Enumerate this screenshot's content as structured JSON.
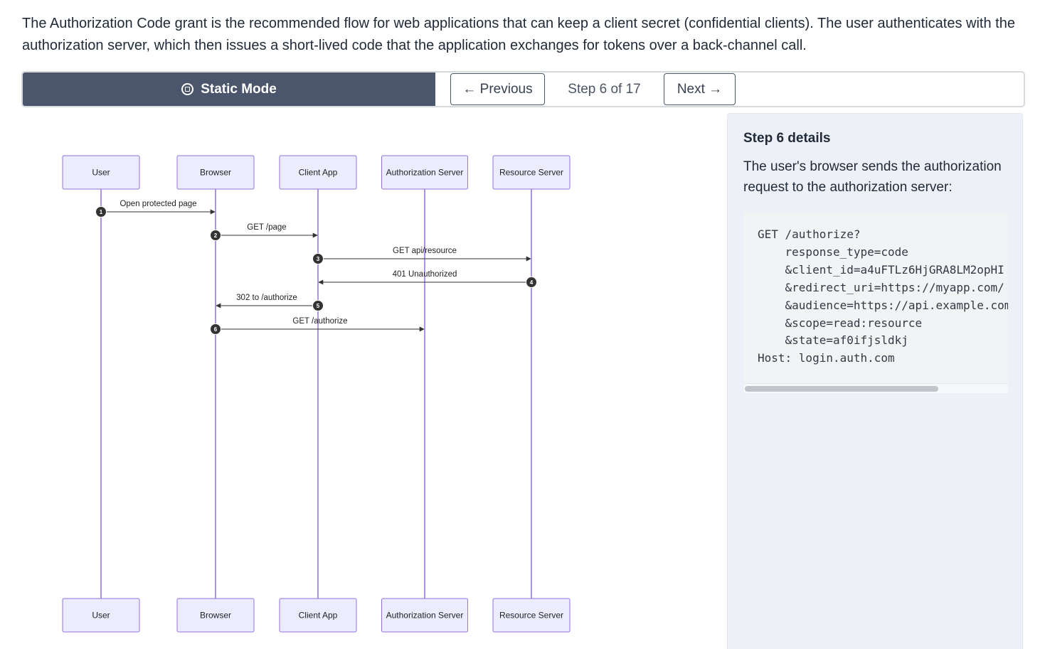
{
  "intro": "The Authorization Code grant is the recommended flow for web applications that can keep a client secret (confidential clients). The user authenticates with the authorization server, which then issues a short-lived code that the application exchanges for tokens over a back-channel call.",
  "toolbar": {
    "mode_label": "Static Mode",
    "prev_label": "← Previous",
    "step_label": "Step 6 of 17",
    "next_label": "Next →"
  },
  "diagram": {
    "participants": [
      "User",
      "Browser",
      "Client App",
      "Authorization Server",
      "Resource Server"
    ],
    "messages": [
      {
        "num": "1",
        "label": "Open protected page",
        "from": 0,
        "to": 1
      },
      {
        "num": "2",
        "label": "GET /page",
        "from": 1,
        "to": 2
      },
      {
        "num": "3",
        "label": "GET api/resource",
        "from": 2,
        "to": 4
      },
      {
        "num": "4",
        "label": "401 Unauthorized",
        "from": 4,
        "to": 2
      },
      {
        "num": "5",
        "label": "302 to /authorize",
        "from": 2,
        "to": 1
      },
      {
        "num": "6",
        "label": "GET /authorize",
        "from": 1,
        "to": 3
      }
    ],
    "colors": {
      "box_fill": "#ececff",
      "box_stroke": "#9370db",
      "lifeline": "#9370db",
      "arrow": "#333333",
      "marker": "#333333"
    }
  },
  "details": {
    "title": "Step 6 details",
    "description": "The user's browser sends the authorization request to the authorization server:",
    "code": "GET /authorize?\n    response_type=code\n    &client_id=a4uFTLz6HjGRA8LM2opHI\n    &redirect_uri=https://myapp.com/\n    &audience=https://api.example.com\n    &scope=read:resource\n    &state=af0ifjsldkj\nHost: login.auth.com"
  }
}
